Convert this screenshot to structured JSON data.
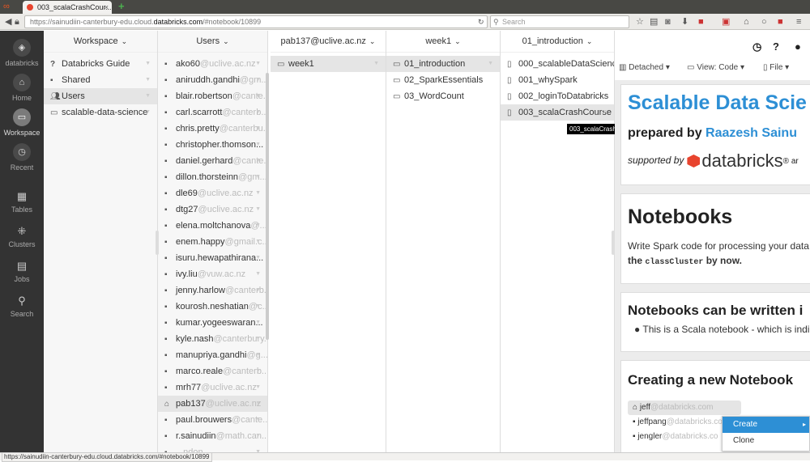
{
  "browser": {
    "tab_title": "003_scalaCrashCour...",
    "url_prefix": "https://sainudiin-canterbury-edu.cloud.",
    "url_domain": "databricks.com",
    "url_suffix": "/#notebook/10899",
    "search_placeholder": "Search",
    "new_tab": "+",
    "tab_close": "×"
  },
  "sidebar": {
    "items": [
      {
        "label": "databricks",
        "icon": "databricks-logo-icon"
      },
      {
        "label": "Home",
        "icon": "home-icon"
      },
      {
        "label": "Workspace",
        "icon": "folder-icon"
      },
      {
        "label": "Recent",
        "icon": "clock-icon"
      },
      {
        "label": "Tables",
        "icon": "table-icon"
      },
      {
        "label": "Clusters",
        "icon": "cluster-icon"
      },
      {
        "label": "Jobs",
        "icon": "calendar-icon"
      },
      {
        "label": "Search",
        "icon": "search-icon"
      }
    ]
  },
  "columns": {
    "workspace": {
      "title": "Workspace",
      "items": [
        {
          "label": "Databricks Guide",
          "icon": "?"
        },
        {
          "label": "Shared",
          "icon": "shared-icon"
        },
        {
          "label": "Users",
          "icon": "users-icon"
        },
        {
          "label": "scalable-data-science",
          "icon": "folder-icon"
        }
      ]
    },
    "users": {
      "title": "Users",
      "items": [
        {
          "name": "ako60",
          "domain": "@uclive.ac.nz"
        },
        {
          "name": "aniruddh.gandhi",
          "domain": "@gm..."
        },
        {
          "name": "blair.robertson",
          "domain": "@cante..."
        },
        {
          "name": "carl.scarrott",
          "domain": "@canterb..."
        },
        {
          "name": "chris.pretty",
          "domain": "@canterbu..."
        },
        {
          "name": "christopher.thomson...",
          "domain": ""
        },
        {
          "name": "daniel.gerhard",
          "domain": "@cante..."
        },
        {
          "name": "dillon.thorsteinn",
          "domain": "@gm..."
        },
        {
          "name": "dle69",
          "domain": "@uclive.ac.nz"
        },
        {
          "name": "dtg27",
          "domain": "@uclive.ac.nz"
        },
        {
          "name": "elena.moltchanova",
          "domain": "@..."
        },
        {
          "name": "enem.happy",
          "domain": "@gmail.c..."
        },
        {
          "name": "isuru.hewapathirana...",
          "domain": ""
        },
        {
          "name": "ivy.liu",
          "domain": "@vuw.ac.nz"
        },
        {
          "name": "jenny.harlow",
          "domain": "@canterb..."
        },
        {
          "name": "kourosh.neshatian",
          "domain": "@c..."
        },
        {
          "name": "kumar.yogeeswaran...",
          "domain": ""
        },
        {
          "name": "kyle.nash",
          "domain": "@canterbury..."
        },
        {
          "name": "manupriya.gandhi",
          "domain": "@g..."
        },
        {
          "name": "marco.reale",
          "domain": "@canterb..."
        },
        {
          "name": "mrh77",
          "domain": "@uclive.ac.nz"
        },
        {
          "name": "pab137",
          "domain": "@uclive.ac.nz"
        },
        {
          "name": "paul.brouwers",
          "domain": "@cante..."
        },
        {
          "name": "r.sainudiin",
          "domain": "@math.can..."
        },
        {
          "name": "",
          "domain": "...ndon"
        }
      ]
    },
    "user": {
      "title": "pab137@uclive.ac.nz",
      "items": [
        {
          "label": "week1"
        }
      ]
    },
    "week": {
      "title": "week1",
      "items": [
        {
          "label": "01_introduction"
        },
        {
          "label": "02_SparkEssentials"
        },
        {
          "label": "03_WordCount"
        }
      ]
    },
    "intro": {
      "title": "01_introduction",
      "items": [
        {
          "label": "000_scalableDataScience"
        },
        {
          "label": "001_whySpark"
        },
        {
          "label": "002_loginToDatabricks"
        },
        {
          "label": "003_scalaCrashCourse"
        }
      ]
    }
  },
  "tooltip": "003_scalaCrashCourse",
  "notebook": {
    "menu": {
      "detached": "Detached",
      "view": "View: Code",
      "file": "File"
    },
    "title": "Scalable Data Scie",
    "prepared_by": "prepared by ",
    "author": "Raazesh Sainu",
    "supported_by": "supported by",
    "brand": "databricks",
    "brand_after": "® ar",
    "h_notebooks": "Notebooks",
    "notebooks_text1": "Write Spark code for processing your data i",
    "notebooks_text2_pre": "the ",
    "notebooks_code": "classCluster",
    "notebooks_text2_post": " by now.",
    "h_written": "Notebooks can be written i",
    "written_bullet": "This is a Scala notebook - which is indic",
    "h_creating": "Creating a new Notebook",
    "user_rows": [
      {
        "name": "jeff",
        "domain": "@databricks.com"
      },
      {
        "name": "jeffpang",
        "domain": "@databricks.co"
      },
      {
        "name": "jengler",
        "domain": "@databricks.co"
      }
    ]
  },
  "context_menu": {
    "items": [
      {
        "label": "Create",
        "submenu": "▸"
      },
      {
        "label": "Clone"
      }
    ]
  },
  "status_url": "https://sainudiin-canterbury-edu.cloud.databricks.com/#notebook/10899"
}
